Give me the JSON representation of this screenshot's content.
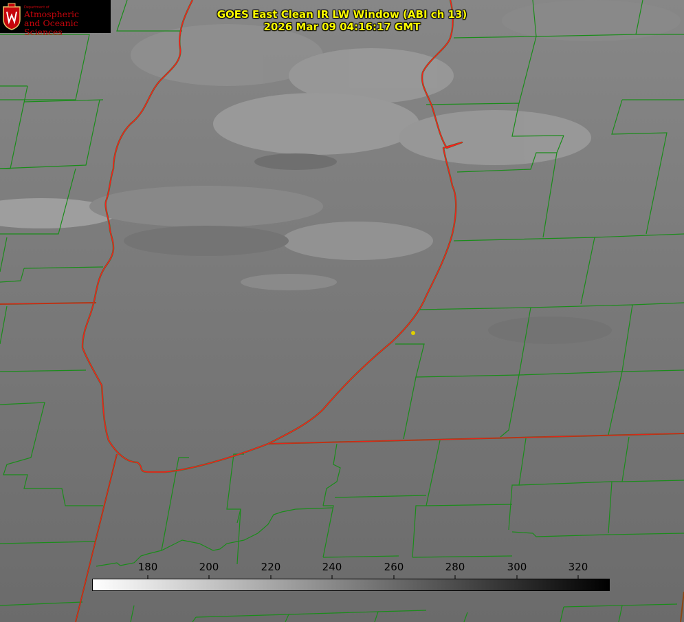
{
  "header": {
    "title_line1": "GOES East Clean IR LW Window (ABI ch 13)",
    "title_line2": "2026 Mar 09 04:16:17 GMT",
    "title_color": "#ffff00"
  },
  "logo": {
    "dept": "Department of",
    "line1": "Atmospheric",
    "line2": "and Oceanic Sciences",
    "color": "#c5050c"
  },
  "colorbar": {
    "ticks": [
      "180",
      "200",
      "220",
      "240",
      "260",
      "280",
      "300",
      "320"
    ],
    "gradient_from": "#ffffff",
    "gradient_to": "#000000"
  },
  "map": {
    "shoreline_color": "#ff1a1a",
    "county_color": "#1a8c1a",
    "state_color": "#8b4513",
    "marker_color": "#e0d000"
  }
}
